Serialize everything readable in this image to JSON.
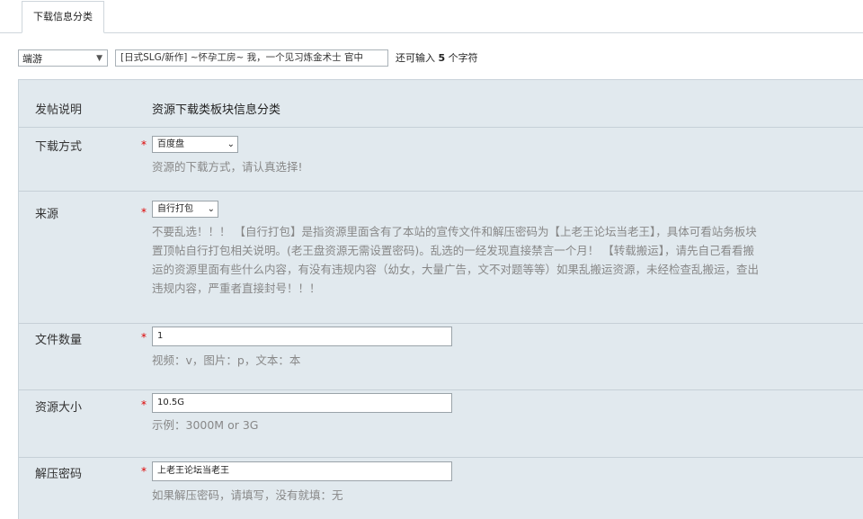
{
  "tab": {
    "label": "下载信息分类"
  },
  "topbar": {
    "category_value": "端游",
    "title_value": "[日式SLG/新作] ~怀孕工房~ 我，一个见习炼金术士 官中",
    "remaining_prefix": "还可输入",
    "remaining_count": "5",
    "remaining_suffix": "个字符"
  },
  "form": {
    "desc_label": "发帖说明",
    "desc_value": "资源下载类板块信息分类",
    "download_method": {
      "label": "下载方式",
      "required": "*",
      "selected": "百度盘",
      "hint": "资源的下载方式，请认真选择!"
    },
    "source": {
      "label": "来源",
      "required": "*",
      "selected": "自行打包",
      "hint_lines": [
        "不要乱选！！！ 【自行打包】是指资源里面含有了本站的宣传文件和解压密码为【上老王论坛当老王】，具体可看站务板块",
        "置顶帖自行打包相关说明。(老王盘资源无需设置密码)。乱选的一经发现直接禁言一个月！ 【转载搬运】，请先自己看看搬",
        "运的资源里面有些什么内容，有没有违规内容（幼女，大量广告，文不对题等等）如果乱搬运资源，未经检查乱搬运，查出",
        "违规内容，严重者直接封号！！！"
      ]
    },
    "file_count": {
      "label": "文件数量",
      "required": "*",
      "value": "1",
      "hint": "视频：v，图片：p，文本：本"
    },
    "size": {
      "label": "资源大小",
      "required": "*",
      "value": "10.5G",
      "hint": "示例：3000M or 3G"
    },
    "password": {
      "label": "解压密码",
      "required": "*",
      "value": "上老王论坛当老王",
      "hint": "如果解压密码，请填写，没有就填：无"
    }
  }
}
